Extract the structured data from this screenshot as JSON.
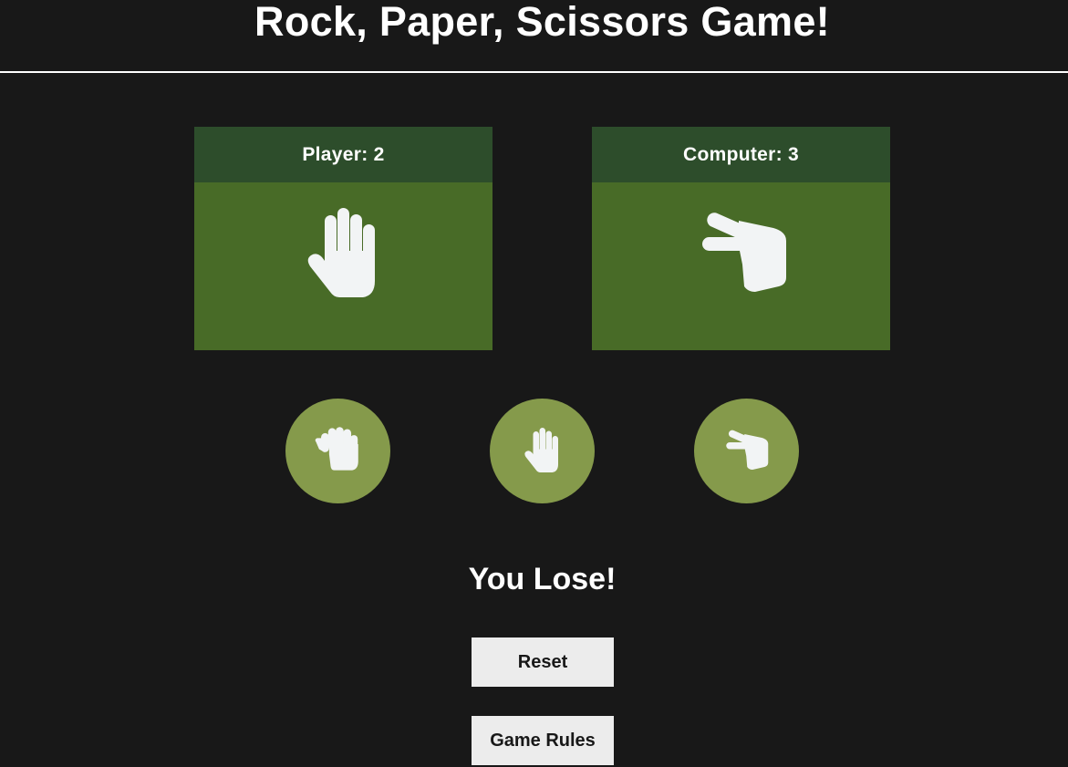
{
  "title": "Rock, Paper, Scissors Game!",
  "player": {
    "label": "Player: 2",
    "hand_icon": "paper-hand-icon"
  },
  "computer": {
    "label": "Computer: 3",
    "hand_icon": "scissors-hand-icon"
  },
  "choices": [
    {
      "name": "rock",
      "icon": "rock-hand-icon"
    },
    {
      "name": "paper",
      "icon": "paper-hand-icon"
    },
    {
      "name": "scissors",
      "icon": "scissors-hand-icon"
    }
  ],
  "result": "You Lose!",
  "buttons": {
    "reset": "Reset",
    "rules": "Game Rules"
  },
  "colors": {
    "background": "#181818",
    "card_body": "#486b27",
    "card_header": "#2d4d2b",
    "choice_circle": "#859a4b",
    "button": "#ececec",
    "icon": "#f2f4f5"
  }
}
